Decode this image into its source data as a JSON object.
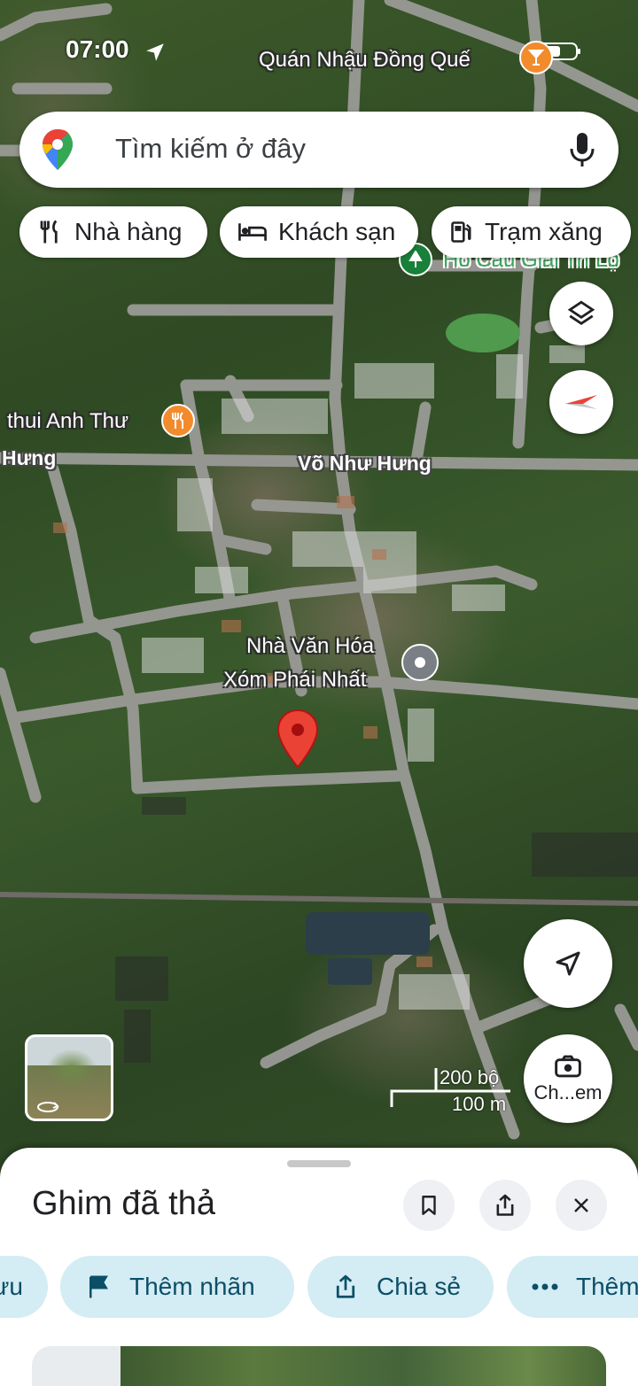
{
  "status_bar": {
    "time": "07:00"
  },
  "search": {
    "placeholder": "Tìm kiếm ở đây"
  },
  "chips": [
    {
      "label": "Nhà hàng",
      "icon": "restaurant-icon"
    },
    {
      "label": "Khách sạn",
      "icon": "hotel-icon"
    },
    {
      "label": "Trạm xăng",
      "icon": "gas-station-icon"
    }
  ],
  "map": {
    "places": [
      {
        "name": "Quán Nhậu Đồng Quế",
        "icon": "bar-icon",
        "color": "#f28b2c"
      },
      {
        "name": "Hồ Câu Giải Trí Lộ",
        "icon": "park-icon",
        "color": "#188038"
      },
      {
        "name": "thui Anh Thư",
        "icon": "restaurant-icon",
        "color": "#f28b2c"
      },
      {
        "name": "Nhà Văn Hóa",
        "name_line2": "Xóm Phái Nhất",
        "icon": "landmark-icon",
        "color": "#5f6368"
      }
    ],
    "roads": [
      "Võ Như Hưng",
      "Hưng"
    ],
    "pin_color": "#ea4335",
    "scale": {
      "imperial": "200 bộ",
      "metric": "100 m"
    },
    "camera_label": "Ch...em"
  },
  "sheet": {
    "title": "Ghim đã thả",
    "actions": [
      {
        "label": "ưu",
        "icon": "bookmark-icon"
      },
      {
        "label": "Thêm nhãn",
        "icon": "flag-icon"
      },
      {
        "label": "Chia sẻ",
        "icon": "share-icon"
      },
      {
        "label": "Thêm",
        "icon": "more-icon"
      }
    ]
  }
}
